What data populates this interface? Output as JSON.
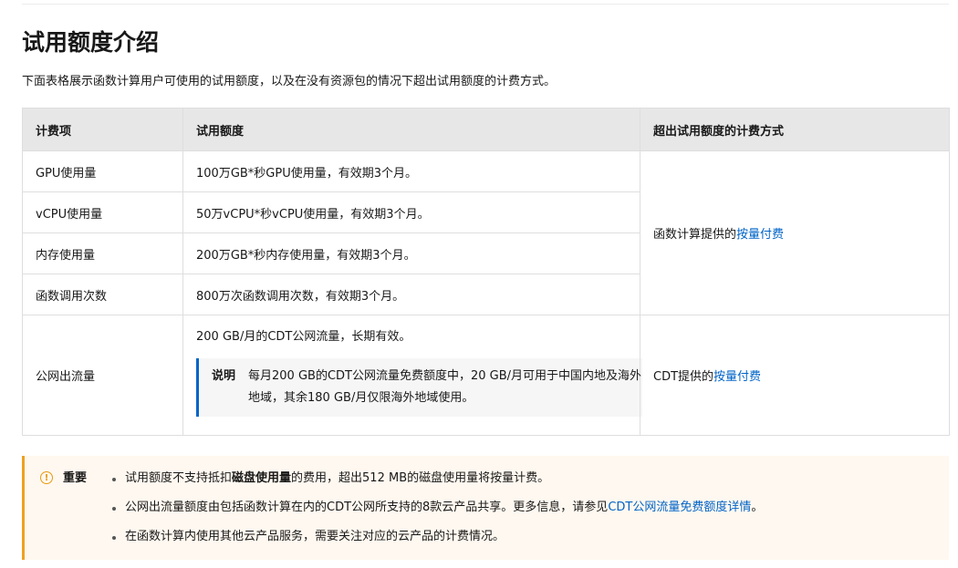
{
  "title": "试用额度介绍",
  "intro": "下面表格展示函数计算用户可使用的试用额度，以及在没有资源包的情况下超出试用额度的计费方式。",
  "table": {
    "headers": [
      "计费项",
      "试用额度",
      "超出试用额度的计费方式"
    ],
    "rows": [
      {
        "item": "GPU使用量",
        "quota": "100万GB*秒GPU使用量，有效期3个月。"
      },
      {
        "item": "vCPU使用量",
        "quota": "50万vCPU*秒vCPU使用量，有效期3个月。"
      },
      {
        "item": "内存使用量",
        "quota": "200万GB*秒内存使用量，有效期3个月。"
      },
      {
        "item": "函数调用次数",
        "quota": "800万次函数调用次数，有效期3个月。"
      }
    ],
    "billing_group1": {
      "prefix": "函数计算提供的",
      "link": "按量付费"
    },
    "traffic_row": {
      "item": "公网出流量",
      "quota": "200 GB/月的CDT公网流量，长期有效。",
      "note_label": "说明",
      "note_text": "每月200 GB的CDT公网流量免费额度中，20 GB/月可用于中国内地及海外地域，其余180 GB/月仅限海外地域使用。",
      "billing_prefix": "CDT提供的",
      "billing_link": "按量付费"
    }
  },
  "important": {
    "label": "重要",
    "icon": "warning-circle-icon",
    "item1_prefix": "试用额度不支持抵扣",
    "item1_bold": "磁盘使用量",
    "item1_suffix": "的费用，超出512 MB的磁盘使用量将按量计费。",
    "item2_prefix": "公网出流量额度由包括函数计算在内的CDT公网所支持的8款云产品共享。更多信息，请参见",
    "item2_link": "CDT公网流量免费额度详情",
    "item2_suffix": "。",
    "item3": "在函数计算内使用其他云产品服务，需要关注对应的云产品的计费情况。"
  },
  "colors": {
    "link": "#0064c8",
    "warning": "#f0a020",
    "header_bg": "#e7e7e7"
  }
}
